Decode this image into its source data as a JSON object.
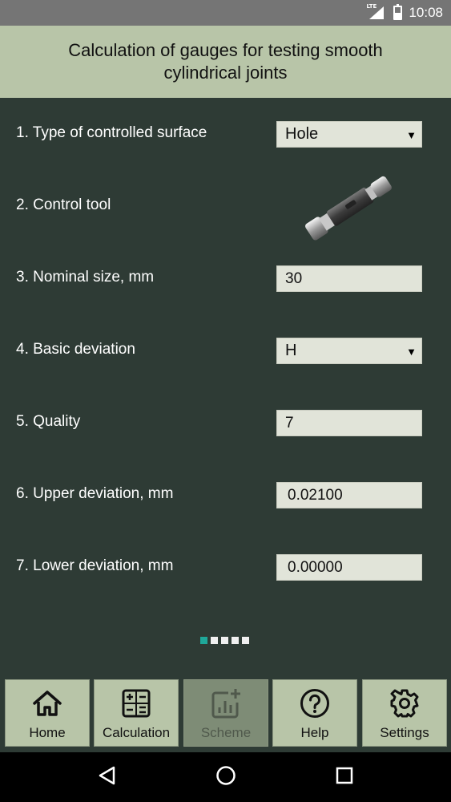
{
  "status_bar": {
    "network": "LTE",
    "time": "10:08",
    "icons": [
      "lte-signal-icon",
      "battery-icon"
    ]
  },
  "header": {
    "title": "Calculation of gauges for testing smooth cylindrical joints"
  },
  "form": {
    "rows": [
      {
        "label": "1. Type of controlled surface",
        "type": "select",
        "value": "Hole"
      },
      {
        "label": "2. Control tool",
        "type": "image",
        "icon": "plug-gauge-image"
      },
      {
        "label": "3. Nominal size, mm",
        "type": "input",
        "value": "30"
      },
      {
        "label": "4. Basic deviation",
        "type": "select",
        "value": "H"
      },
      {
        "label": "5. Quality",
        "type": "input",
        "value": "7"
      },
      {
        "label": "6. Upper deviation, mm",
        "type": "output",
        "value": "0.02100"
      },
      {
        "label": "7. Lower deviation, mm",
        "type": "output",
        "value": "0.00000"
      }
    ]
  },
  "pager": {
    "pages": 5,
    "active_index": 0
  },
  "bottom_nav": {
    "items": [
      {
        "label": "Home",
        "icon": "home-icon",
        "enabled": true
      },
      {
        "label": "Calculation",
        "icon": "calculator-icon",
        "enabled": true
      },
      {
        "label": "Scheme",
        "icon": "scheme-chart-icon",
        "enabled": false
      },
      {
        "label": "Help",
        "icon": "help-icon",
        "enabled": true
      },
      {
        "label": "Settings",
        "icon": "gear-icon",
        "enabled": true
      }
    ]
  },
  "colors": {
    "header_bg": "#b8c5a8",
    "content_bg": "#2e3b35",
    "field_bg": "#e1e4d9",
    "pager_active": "#1fa89a"
  }
}
